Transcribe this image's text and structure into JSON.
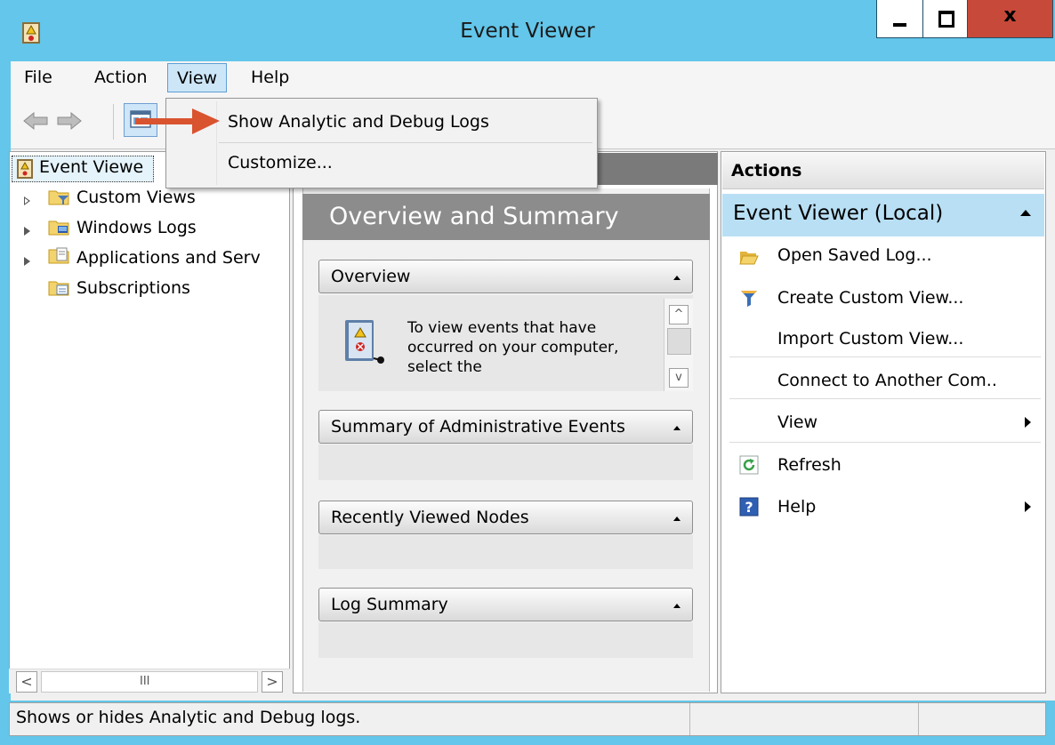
{
  "window": {
    "title": "Event Viewer",
    "minimize_glyph": "",
    "close_glyph": "x"
  },
  "menubar": {
    "file": "File",
    "action": "Action",
    "view": "View",
    "help": "Help"
  },
  "view_menu": {
    "items": [
      {
        "label": "Show Analytic and Debug Logs"
      },
      {
        "label": "Customize..."
      }
    ]
  },
  "tree": {
    "root": "Event Viewer (Local)",
    "root_visible": "Event Viewe",
    "items": [
      {
        "label": "Custom Views",
        "expandable": true
      },
      {
        "label": "Windows Logs",
        "expandable": true
      },
      {
        "label": "Applications and Serv",
        "expandable": true
      },
      {
        "label": "Subscriptions",
        "expandable": false
      }
    ],
    "scroll_grip": "III"
  },
  "center": {
    "title": "Overview and Summary",
    "sections": [
      {
        "label": "Overview"
      },
      {
        "label": "Summary of Administrative Events"
      },
      {
        "label": "Recently Viewed Nodes"
      },
      {
        "label": "Log Summary"
      }
    ],
    "overview_text": "To view events that have occurred on your computer, select the"
  },
  "actions": {
    "header": "Actions",
    "group": "Event Viewer (Local)",
    "items": [
      {
        "label": "Open Saved Log...",
        "icon": "open-folder-icon"
      },
      {
        "label": "Create Custom View...",
        "icon": "filter-icon"
      },
      {
        "label": "Import Custom View...",
        "icon": ""
      },
      {
        "label": "Connect to Another Com..",
        "icon": ""
      },
      {
        "label": "View",
        "icon": "",
        "submenu": true
      },
      {
        "label": "Refresh",
        "icon": "refresh-icon"
      },
      {
        "label": "Help",
        "icon": "help-icon",
        "submenu": true
      }
    ]
  },
  "statusbar": {
    "text": "Shows or hides Analytic and Debug logs."
  },
  "colors": {
    "titlebar": "#63c6ea",
    "close_button": "#c7493a",
    "selection": "#b9dff4",
    "annotation_arrow": "#d9532f"
  }
}
